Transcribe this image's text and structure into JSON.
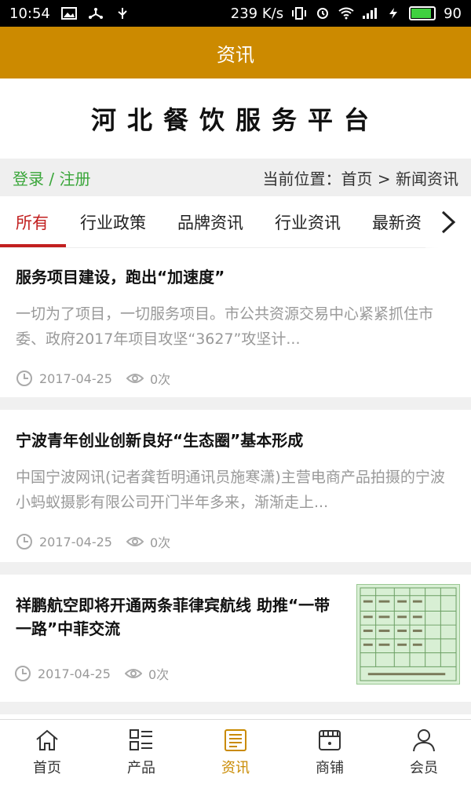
{
  "status_bar": {
    "time": "10:54",
    "speed": "239 K/s",
    "battery": "90"
  },
  "header": {
    "title": "资讯"
  },
  "banner": {
    "logo_text": "河北餐饮服务平台"
  },
  "crumb": {
    "login": "登录 / 注册",
    "location": "当前位置：首页 > 新闻资讯"
  },
  "tabs": [
    {
      "label": "所有"
    },
    {
      "label": "行业政策"
    },
    {
      "label": "品牌资讯"
    },
    {
      "label": "行业资讯"
    },
    {
      "label": "最新资"
    }
  ],
  "articles": [
    {
      "title": "服务项目建设，跑出“加速度”",
      "summary": "一切为了项目，一切服务项目。市公共资源交易中心紧紧抓住市委、政府2017年项目攻坚“3627”攻坚计...",
      "date": "2017-04-25",
      "views": "0次"
    },
    {
      "title": "宁波青年创业创新良好“生态圈”基本形成",
      "summary": "中国宁波网讯(记者龚哲明通讯员施寒潇)主营电商产品拍摄的宁波小蚂蚁摄影有限公司开门半年多来，渐渐走上...",
      "date": "2017-04-25",
      "views": "0次"
    },
    {
      "title": "祥鹏航空即将开通两条菲律宾航线 助推“一带一路”中菲交流",
      "date": "2017-04-25",
      "views": "0次"
    }
  ],
  "bottom_nav": [
    {
      "label": "首页",
      "icon": "home-icon"
    },
    {
      "label": "产品",
      "icon": "product-grid-icon"
    },
    {
      "label": "资讯",
      "icon": "news-icon"
    },
    {
      "label": "商铺",
      "icon": "shop-icon"
    },
    {
      "label": "会员",
      "icon": "member-icon"
    }
  ],
  "colors": {
    "header": "#cc8a00",
    "accent": "#c21f1f",
    "login": "#3aa63a",
    "nav_active": "#c98a00"
  }
}
